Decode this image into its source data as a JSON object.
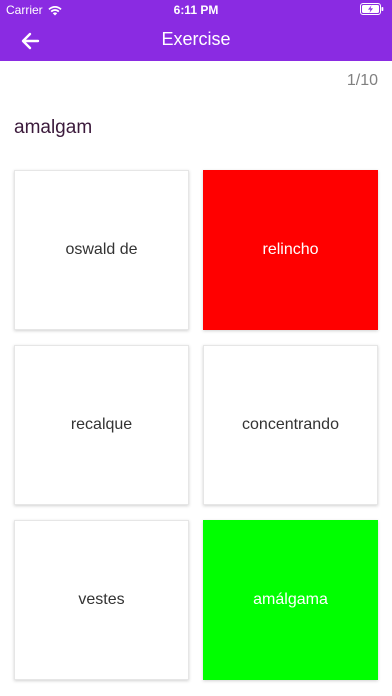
{
  "status_bar": {
    "carrier": "Carrier",
    "time": "6:11 PM",
    "wifi_icon": "wifi-icon",
    "battery_icon": "battery-charging-icon"
  },
  "nav": {
    "title": "Exercise",
    "back_icon": "arrow-left-icon"
  },
  "progress": "1/10",
  "question": "amalgam",
  "options": [
    {
      "label": "oswald de",
      "state": "normal"
    },
    {
      "label": "relincho",
      "state": "wrong"
    },
    {
      "label": "recalque",
      "state": "normal"
    },
    {
      "label": "concentrando",
      "state": "normal"
    },
    {
      "label": "vestes",
      "state": "normal"
    },
    {
      "label": "amálgama",
      "state": "correct"
    }
  ],
  "colors": {
    "header": "#8a2be2",
    "wrong": "#ff0000",
    "correct": "#00ff00"
  }
}
